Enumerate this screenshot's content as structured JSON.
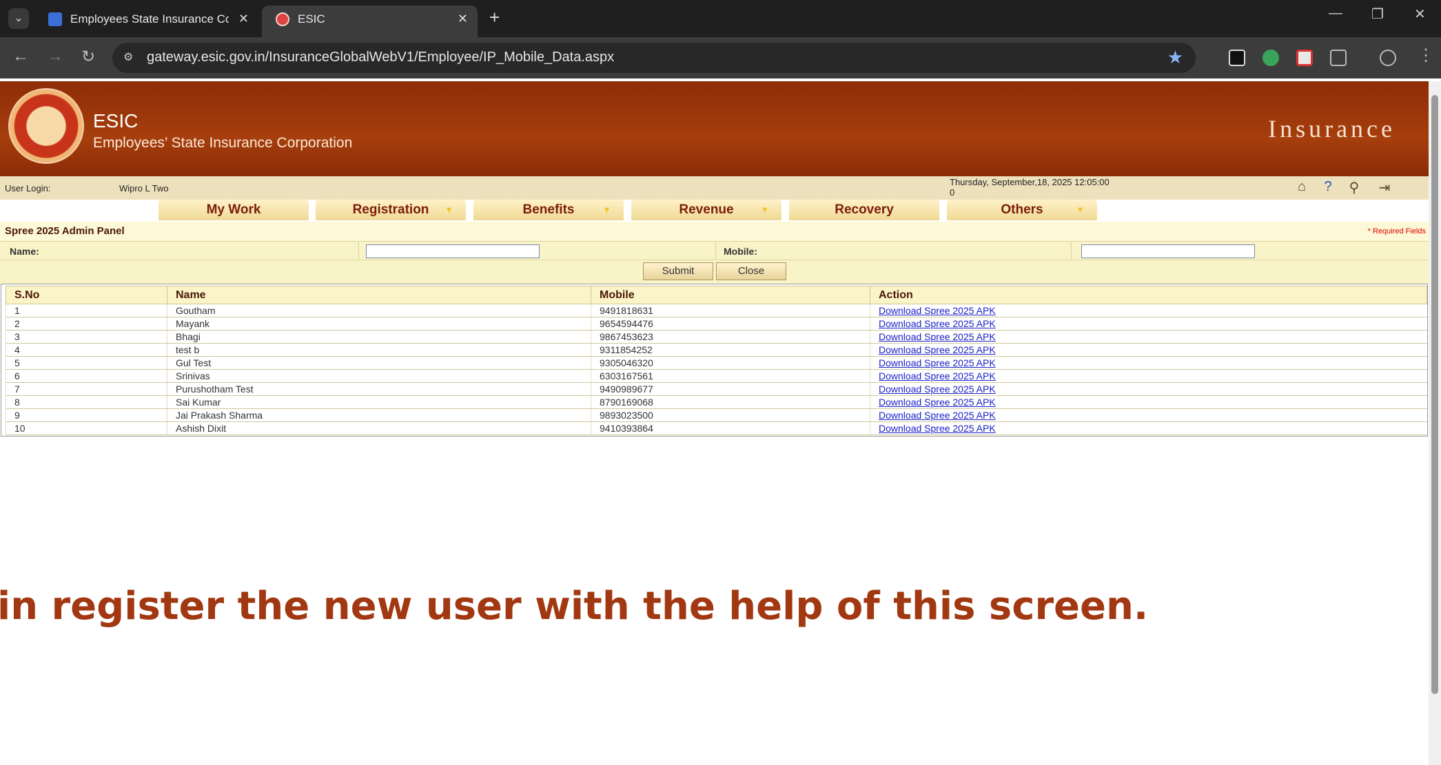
{
  "browser": {
    "tabs": [
      {
        "title": "Employees State Insurance Corp"
      },
      {
        "title": "ESIC"
      }
    ],
    "url": "gateway.esic.gov.in/InsuranceGlobalWebV1/Employee/IP_Mobile_Data.aspx"
  },
  "header": {
    "brand_short": "ESIC",
    "brand_full": "Employees’ State Insurance Corporation",
    "module": "Insurance"
  },
  "userbar": {
    "login_label": "User Login:",
    "login_value": "Wipro L Two",
    "datetime": "Thursday, September,18, 2025 12:05:00",
    "datetime_line2": "0"
  },
  "menu": [
    {
      "label": "My Work",
      "dropdown": false
    },
    {
      "label": "Registration",
      "dropdown": true
    },
    {
      "label": "Benefits",
      "dropdown": true
    },
    {
      "label": "Revenue",
      "dropdown": true
    },
    {
      "label": "Recovery",
      "dropdown": false
    },
    {
      "label": "Others",
      "dropdown": true
    }
  ],
  "panel": {
    "title": "Spree 2025 Admin Panel",
    "required_note": "* Required Fields"
  },
  "form": {
    "name_label": "Name:",
    "name_value": "",
    "mobile_label": "Mobile:",
    "mobile_value": "",
    "submit_label": "Submit",
    "close_label": "Close"
  },
  "table": {
    "headers": [
      "S.No",
      "Name",
      "Mobile",
      "Action"
    ],
    "rows": [
      {
        "sno": "1",
        "name": "Goutham",
        "mobile": "9491818631",
        "action": "Download Spree 2025 APK"
      },
      {
        "sno": "2",
        "name": "Mayank",
        "mobile": "9654594476",
        "action": "Download Spree 2025 APK"
      },
      {
        "sno": "3",
        "name": "Bhagi",
        "mobile": "9867453623",
        "action": "Download Spree 2025 APK"
      },
      {
        "sno": "4",
        "name": "test b",
        "mobile": "9311854252",
        "action": "Download Spree 2025 APK"
      },
      {
        "sno": "5",
        "name": "Gul Test",
        "mobile": "9305046320",
        "action": "Download Spree 2025 APK"
      },
      {
        "sno": "6",
        "name": "Srinivas",
        "mobile": "6303167561",
        "action": "Download Spree 2025 APK"
      },
      {
        "sno": "7",
        "name": "Purushotham Test",
        "mobile": "9490989677",
        "action": "Download Spree 2025 APK"
      },
      {
        "sno": "8",
        "name": "Sai Kumar",
        "mobile": "8790169068",
        "action": "Download Spree 2025 APK"
      },
      {
        "sno": "9",
        "name": "Jai Prakash Sharma",
        "mobile": "9893023500",
        "action": "Download Spree 2025 APK"
      },
      {
        "sno": "10",
        "name": "Ashish Dixit",
        "mobile": "9410393864",
        "action": "Download Spree 2025 APK"
      }
    ]
  },
  "caption": "in register the new user with the help of this screen.",
  "colors": {
    "banner": "#9a3409",
    "caption": "#a23811",
    "link": "#1a21c8"
  }
}
